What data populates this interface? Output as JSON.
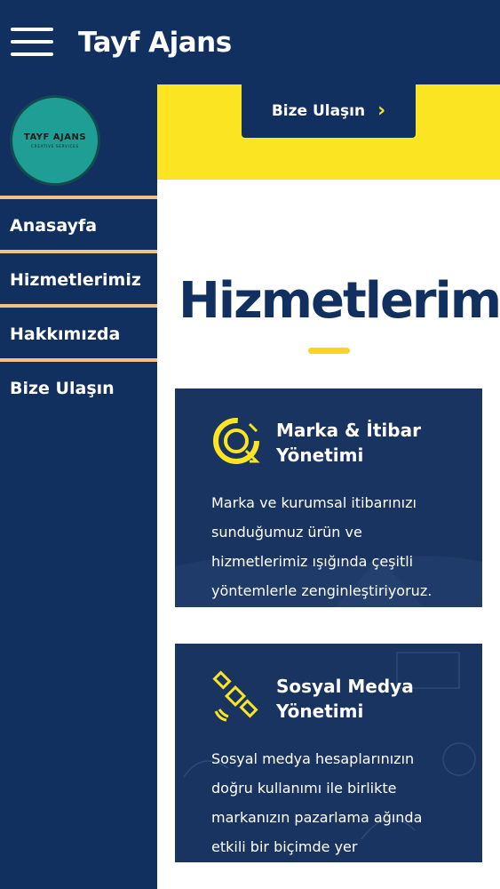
{
  "appbar": {
    "title": "Tayf Ajans",
    "menu_icon": "hamburger-menu-icon"
  },
  "drawer": {
    "logo": {
      "main": "TAYF AJANS",
      "sub": "CREATIVE SERVICES"
    },
    "nav_items": [
      {
        "label": "Anasayfa"
      },
      {
        "label": "Hizmetlerimiz"
      },
      {
        "label": "Hakkımızda"
      },
      {
        "label": "Bize Ulaşın"
      }
    ]
  },
  "hero": {
    "cta_label": "Bize Ulaşın",
    "cta_icon": "chevron-right-icon"
  },
  "services": {
    "heading": "Hizmetlerimiz",
    "cards": [
      {
        "icon": "brand-reputation-icon",
        "title_line1": "Marka & İtibar",
        "title_line2": "Yönetimi",
        "text_lines": [
          "Marka ve kurumsal itibarınızı",
          "sunduğumuz ürün ve",
          "hizmetlerimiz ışığında çeşitli",
          "yöntemlerle zenginleştiriyoruz."
        ]
      },
      {
        "icon": "satellite-icon",
        "title_line1": "Sosyal Medya",
        "title_line2": "Yönetimi",
        "text_lines": [
          "Sosyal medya hesaplarınızın",
          "doğru kullanımı ile birlikte",
          "markanızın pazarlama ağında",
          "etkili bir biçimde  yer"
        ]
      }
    ]
  },
  "colors": {
    "navy": "#11305f",
    "yellow": "#fbe422",
    "nav_divider": "#f2c185",
    "logo_teal": "#1f9e95"
  }
}
